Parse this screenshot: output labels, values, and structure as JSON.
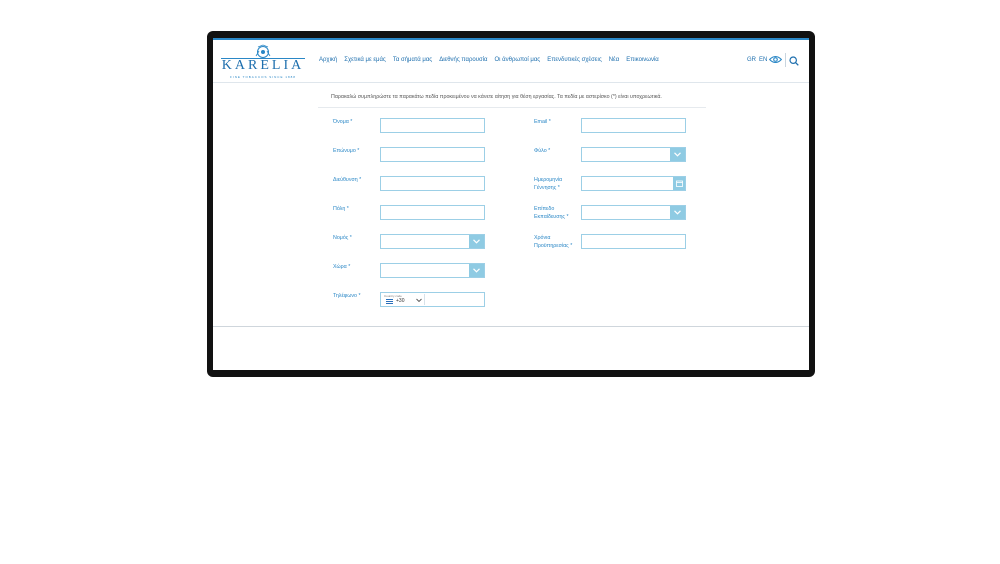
{
  "brand": {
    "name": "KARELIA",
    "tagline": "FINE TOBACCOS SINCE 1888",
    "accent": "#2a87c6"
  },
  "nav": [
    "Αρχική",
    "Σχετικά με εμάς",
    "Τα σήματά μας",
    "Διεθνής παρουσία",
    "Οι άνθρωποί μας",
    "Επενδυτικές σχέσεις",
    "Νέα",
    "Επικοινωνία"
  ],
  "lang": {
    "gr": "GR",
    "en": "EN"
  },
  "icons": {
    "accessibility": "eye-icon",
    "search": "search-icon"
  },
  "form": {
    "intro": "Παρακαλώ συμπληρώστε τα παρακάτω πεδία προκειμένου να κάνετε αίτηση για θέση εργασίας. Τα πεδία με αστερίσκο (*) είναι υποχρεωτικά.",
    "left": [
      {
        "label": "Όνομα *",
        "type": "text",
        "value": ""
      },
      {
        "label": "Επώνυμο *",
        "type": "text",
        "value": ""
      },
      {
        "label": "Διεύθυνση *",
        "type": "text",
        "value": ""
      },
      {
        "label": "Πόλη *",
        "type": "text",
        "value": ""
      },
      {
        "label": "Νομός *",
        "type": "select",
        "value": ""
      },
      {
        "label": "Χώρα *",
        "type": "select",
        "value": ""
      },
      {
        "label": "Τηλέφωνο *",
        "type": "phone",
        "country_code_label": "Country code",
        "country_code": "+30",
        "value": ""
      }
    ],
    "right": [
      {
        "label": "Email *",
        "type": "text",
        "value": ""
      },
      {
        "label": "Φύλο *",
        "type": "select",
        "value": ""
      },
      {
        "label": "Ημερομηνία Γέννησης *",
        "type": "date",
        "value": ""
      },
      {
        "label": "Επίπεδο Εκπαίδευσης *",
        "type": "select",
        "value": ""
      },
      {
        "label": "Χρόνια Προϋπηρεσίας *",
        "type": "text",
        "value": ""
      }
    ]
  }
}
